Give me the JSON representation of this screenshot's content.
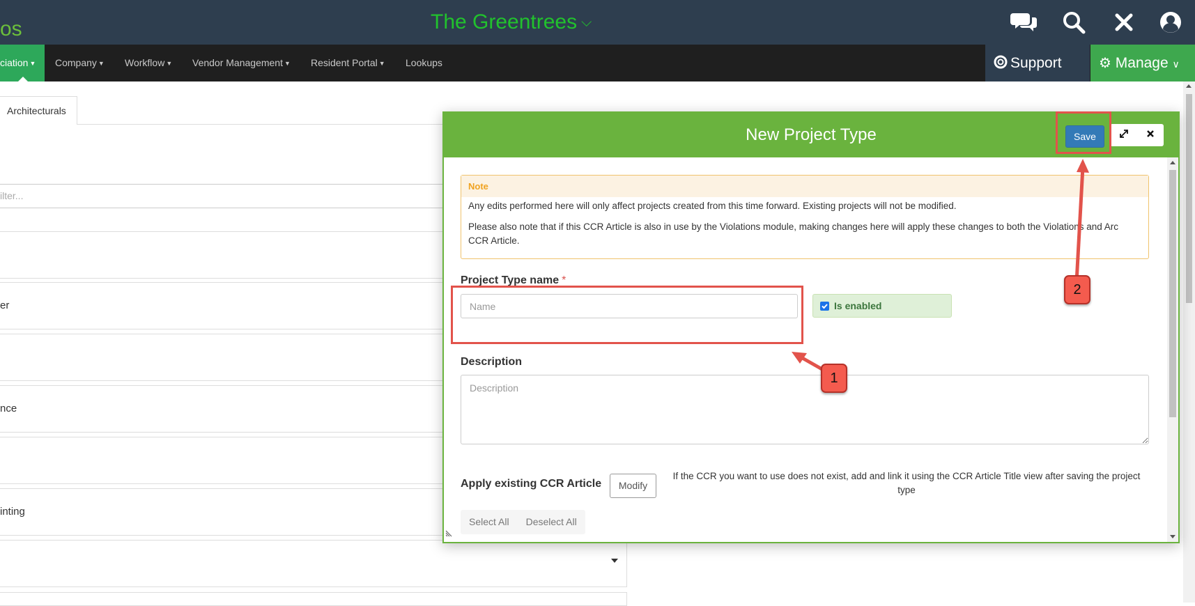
{
  "header": {
    "brand_partial": "os",
    "community_title": "The Greentrees",
    "icons": [
      "chat-icon",
      "search-icon",
      "close-icon",
      "user-icon"
    ]
  },
  "menu": {
    "items": [
      {
        "label": "ciation"
      },
      {
        "label": "Company"
      },
      {
        "label": "Workflow"
      },
      {
        "label": "Vendor Management"
      },
      {
        "label": "Resident Portal"
      },
      {
        "label": "Lookups"
      }
    ],
    "support_label": "Support",
    "manage_label": "Manage"
  },
  "background": {
    "tab_label": "Architecturals",
    "filter_placeholder": "ilter...",
    "rows": [
      "",
      "er",
      "",
      "nce",
      "",
      "inting"
    ]
  },
  "modal": {
    "title": "New Project Type",
    "save_label": "Save",
    "note": {
      "heading": "Note",
      "line1": "Any edits performed here will only affect projects created from this time forward. Existing projects will not be modified.",
      "line2": "Please also note that if this CCR Article is also in use by the Violations module, making changes here will apply these changes to both the Violations and Arc CCR Article."
    },
    "name_label": "Project Type name",
    "name_required_mark": "*",
    "name_placeholder": "Name",
    "enabled_label": "Is enabled",
    "enabled_checked": true,
    "description_label": "Description",
    "description_placeholder": "Description",
    "ccr_label": "Apply existing CCR Article",
    "modify_label": "Modify",
    "ccr_help": "If the CCR you want to use does not exist, add and link it using the CCR Article Title view after saving the project type",
    "select_all_label": "Select All",
    "deselect_all_label": "Deselect All"
  },
  "annotations": {
    "badge1": "1",
    "badge2": "2"
  },
  "colors": {
    "header_bg": "#2e3e4f",
    "brand_green": "#21c22d",
    "modal_header": "#6ab33e",
    "save_blue": "#337ab7",
    "annotation_red": "#e2534b"
  }
}
